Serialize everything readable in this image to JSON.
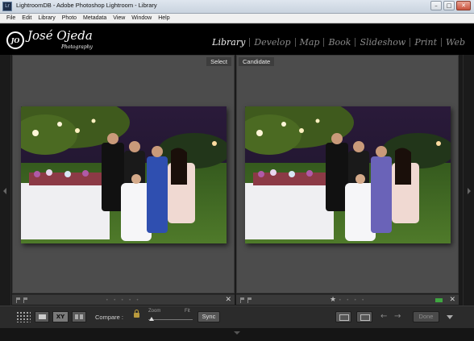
{
  "window": {
    "app_icon_text": "Lr",
    "title": "LightroomDB - Adobe Photoshop Lightroom - Library",
    "controls": {
      "minimize": "–",
      "maximize": "□",
      "close": "✕"
    }
  },
  "menu": [
    "File",
    "Edit",
    "Library",
    "Photo",
    "Metadata",
    "View",
    "Window",
    "Help"
  ],
  "identity_plate": {
    "monogram": "JO",
    "name": "José Ojeda",
    "subtitle": "Photography"
  },
  "modules": [
    {
      "label": "Library",
      "active": true
    },
    {
      "label": "Develop",
      "active": false
    },
    {
      "label": "Map",
      "active": false
    },
    {
      "label": "Book",
      "active": false
    },
    {
      "label": "Slideshow",
      "active": false
    },
    {
      "label": "Print",
      "active": false
    },
    {
      "label": "Web",
      "active": false
    }
  ],
  "compare": {
    "select_label": "Select",
    "candidate_label": "Candidate",
    "select_rating_dots": "• • • • •",
    "candidate_rating_dots": "• • • •",
    "close_glyph": "✕",
    "candidate_star": "★",
    "color_label": "#3fa641"
  },
  "toolbar": {
    "survey_xy_label": "XY",
    "compare_label": "Compare :",
    "zoom_label": "Zoom",
    "fit_label": "Fit",
    "zoom_level": 0,
    "sync_label": "Sync",
    "prev_glyph": "←",
    "next_glyph": "→",
    "done_label": "Done"
  },
  "colors": {
    "pane_background": "#4c4c4c",
    "accent_active_module": "#f2f2f2",
    "inactive_module": "#8a8a8a"
  },
  "icons": [
    "grid-icon",
    "loupe-icon",
    "compare-xy-icon",
    "survey-icon",
    "lock-icon",
    "swap-icon",
    "flag-icon",
    "star-icon"
  ]
}
